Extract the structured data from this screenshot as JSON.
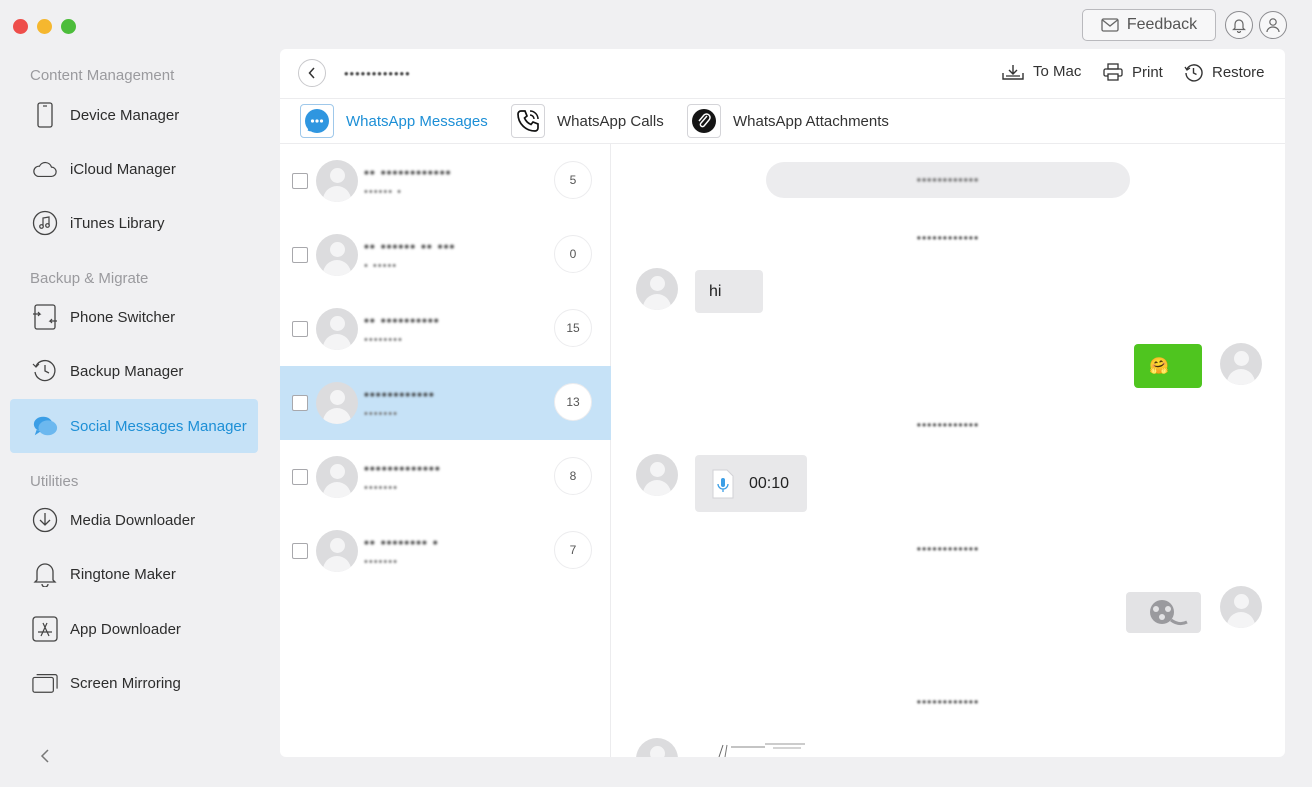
{
  "window": {
    "controls": [
      "close",
      "minimize",
      "maximize"
    ]
  },
  "topbar": {
    "feedback_label": "Feedback"
  },
  "sidebar": {
    "sections": [
      {
        "label": "Content Management"
      },
      {
        "label": "Backup & Migrate"
      },
      {
        "label": "Utilities"
      }
    ],
    "items": [
      {
        "label": "Device Manager",
        "icon": "phone-icon"
      },
      {
        "label": "iCloud Manager",
        "icon": "cloud-icon"
      },
      {
        "label": "iTunes Library",
        "icon": "music-icon"
      },
      {
        "label": "Phone Switcher",
        "icon": "switch-icon"
      },
      {
        "label": "Backup Manager",
        "icon": "history-icon"
      },
      {
        "label": "Social Messages Manager",
        "icon": "chat-bubbles-icon",
        "active": true
      },
      {
        "label": "Media Downloader",
        "icon": "download-icon"
      },
      {
        "label": "Ringtone Maker",
        "icon": "bell-icon"
      },
      {
        "label": "App Downloader",
        "icon": "app-store-icon"
      },
      {
        "label": "Screen Mirroring",
        "icon": "screens-icon"
      }
    ]
  },
  "header": {
    "device_name": "••••••••••••",
    "actions": [
      {
        "label": "To Mac",
        "icon": "export-icon"
      },
      {
        "label": "Print",
        "icon": "printer-icon"
      },
      {
        "label": "Restore",
        "icon": "restore-icon"
      }
    ]
  },
  "tabs": [
    {
      "label": "WhatsApp Messages",
      "icon": "whatsapp-chat-icon",
      "active": true
    },
    {
      "label": "WhatsApp Calls",
      "icon": "phone-call-icon"
    },
    {
      "label": "WhatsApp Attachments",
      "icon": "paperclip-icon"
    }
  ],
  "conversations": [
    {
      "name": "•• ••••••••••••",
      "sub": "•••••• •",
      "count": "5",
      "selected": false
    },
    {
      "name": "•• •••••• •• •••",
      "sub": "• •••••",
      "count": "0",
      "selected": false
    },
    {
      "name": "•• ••••••••••",
      "sub": "••••••••",
      "count": "15",
      "selected": false
    },
    {
      "name": "••••••••••••",
      "sub": "•••••••",
      "count": "13",
      "selected": true
    },
    {
      "name": "•••••••••••••",
      "sub": "•••••••",
      "count": "8",
      "selected": false
    },
    {
      "name": "•• •••••••• •",
      "sub": "•••••••",
      "count": "7",
      "selected": false
    }
  ],
  "chat": {
    "contact": "••••••••••••",
    "timestamps": [
      "••••••••••••",
      "••••••••••••",
      "••••••••••••",
      "••••••••••••"
    ],
    "messages": [
      {
        "direction": "in",
        "type": "text",
        "text": "hi"
      },
      {
        "direction": "out",
        "type": "emoji",
        "text": "🤗"
      },
      {
        "direction": "in",
        "type": "voice",
        "duration": "00:10"
      },
      {
        "direction": "out",
        "type": "video"
      }
    ],
    "colors": {
      "outgoing": "#4fc51f",
      "incoming": "#e8e8ea",
      "accent": "#1d8fd6",
      "selected_bg": "#c6e2f7"
    }
  }
}
